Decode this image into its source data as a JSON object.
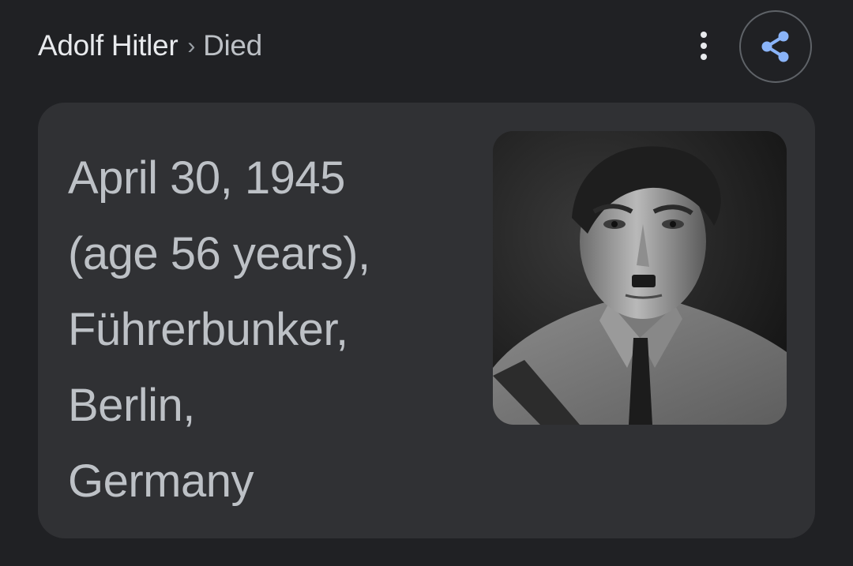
{
  "header": {
    "breadcrumb_primary": "Adolf Hitler",
    "breadcrumb_separator": "›",
    "breadcrumb_secondary": "Died"
  },
  "icons": {
    "more": "more-vert-icon",
    "share": "share-icon"
  },
  "answer": {
    "lines": [
      "April 30, 1945",
      "(age 56 years),",
      "Führerbunker,",
      "Berlin,",
      "Germany"
    ]
  },
  "colors": {
    "background": "#202124",
    "card": "#303134",
    "title_text": "#e8eaed",
    "answer_text": "#bdc1c6",
    "share_accent": "#8ab4f8"
  }
}
